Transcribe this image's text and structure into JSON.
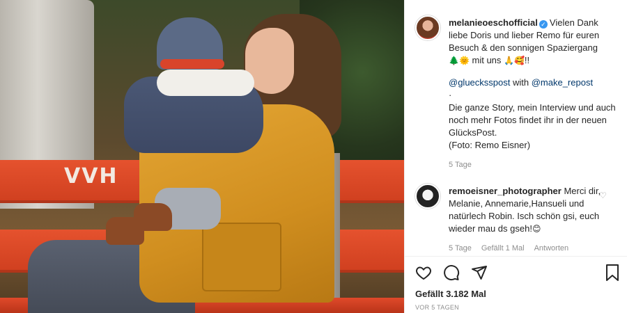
{
  "photo": {
    "bench_text": "VVH"
  },
  "post": {
    "username": "melanieoeschofficial",
    "caption_line1": "Vielen Dank liebe Doris und lieber Remo für euren Besuch & den sonnigen Spaziergang",
    "caption_emoji_a": "🌲🌞",
    "caption_mid": " mit uns ",
    "caption_emoji_b": "🙏🥰",
    "caption_end": "!!",
    "repost_mention": "@gluecksspost",
    "repost_with": " with ",
    "repost_tool": "@make_repost",
    "dot": "·",
    "story_text": "Die ganze Story, mein Interview und auch noch mehr Fotos findet ihr in der neuen GlücksPost.",
    "photo_credit": "(Foto: Remo Eisner)",
    "age": "5 Tage"
  },
  "comment": {
    "username": "remoeisner_photographer",
    "text": " Merci dir, Melanie, Annemarie,Hansueli und natürlech Robin. Isch schön gsi, euch wieder mau ds gseh!",
    "emoji": "😊",
    "age": "5 Tage",
    "likes": "Gefällt 1 Mal",
    "reply": "Antworten"
  },
  "actions": {
    "like_icon": "heart-icon",
    "comment_icon": "comment-icon",
    "share_icon": "send-icon",
    "save_icon": "bookmark-icon",
    "likes_text": "Gefällt 3.182 Mal",
    "timestamp": "VOR 5 TAGEN"
  },
  "colors": {
    "verified": "#3897f0",
    "mention": "#00376b",
    "meta": "#8e8e8e",
    "bench": "#e5522e",
    "jacket": "#e4a634"
  }
}
